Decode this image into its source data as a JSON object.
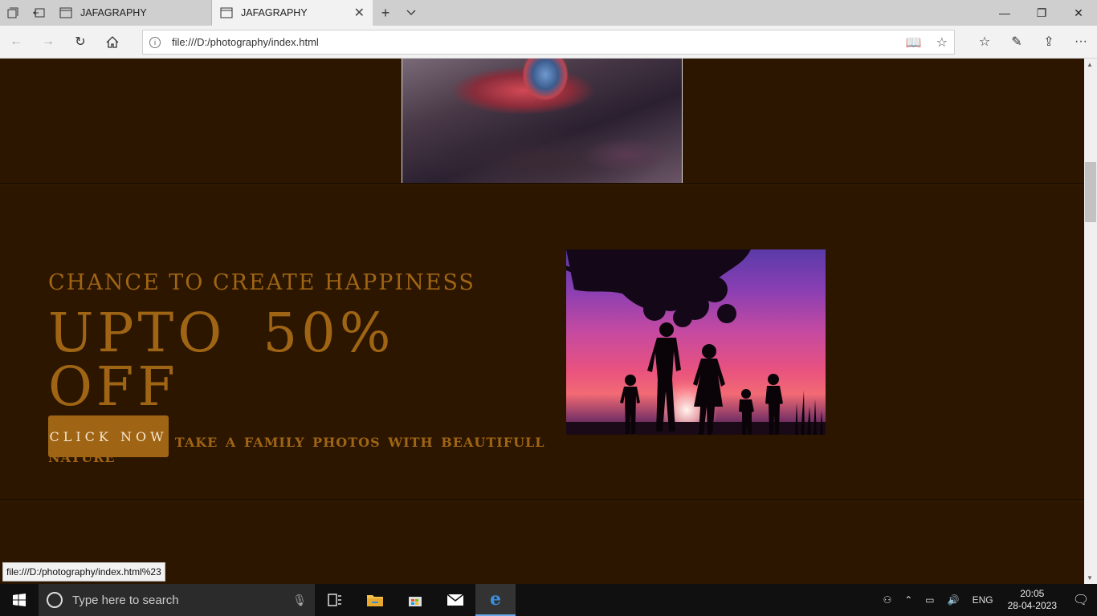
{
  "browser": {
    "tabs": [
      {
        "title": "JAFAGRAPHY",
        "active": false
      },
      {
        "title": "JAFAGRAPHY",
        "active": true
      }
    ],
    "address": "file:///D:/photography/index.html",
    "status_url": "file:///D:/photography/index.html%23"
  },
  "promo": {
    "kicker": "CHANCE TO CREATE HAPPINESS",
    "headline": "UPTO 50% OFF",
    "subtext": "WE HELP YOU TAKE A FAMILY PHOTOS WITH BEAUTIFULL NATURE",
    "cta_label": "CLICK NOW"
  },
  "taskbar": {
    "search_placeholder": "Type here to search",
    "language": "ENG",
    "time": "20:05",
    "date": "28-04-2023"
  },
  "colors": {
    "page_bg": "#2c1600",
    "accent": "#9f6514"
  }
}
